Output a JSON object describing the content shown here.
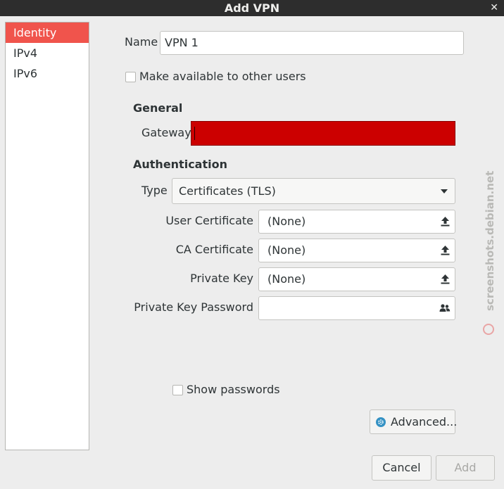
{
  "window": {
    "title": "Add VPN",
    "close_glyph": "✕"
  },
  "sidebar": {
    "items": [
      {
        "label": "Identity",
        "active": true
      },
      {
        "label": "IPv4",
        "active": false
      },
      {
        "label": "IPv6",
        "active": false
      }
    ]
  },
  "identity": {
    "name_label": "Name",
    "name_value": "VPN 1",
    "share_label": "Make available to other users",
    "share_checked": false
  },
  "general": {
    "heading": "General",
    "gateway_label": "Gateway",
    "gateway_value": ""
  },
  "authentication": {
    "heading": "Authentication",
    "type_label": "Type",
    "type_value": "Certificates (TLS)",
    "user_cert_label": "User Certificate",
    "user_cert_value": "(None)",
    "ca_cert_label": "CA Certificate",
    "ca_cert_value": "(None)",
    "private_key_label": "Private Key",
    "private_key_value": "(None)",
    "private_key_password_label": "Private Key Password",
    "private_key_password_value": ""
  },
  "show_passwords_label": "Show passwords",
  "advanced_label": "Advanced...",
  "footer": {
    "cancel_label": "Cancel",
    "add_label": "Add"
  },
  "watermark": "screenshots.debian.net",
  "colors": {
    "selection": "#f0544c",
    "invalid_field": "#cc0000",
    "titlebar": "#2d2d2d",
    "advanced_icon": "#3592c4"
  },
  "icons": {
    "file_chooser": "upload-arrow-icon",
    "password_storage": "users-icon",
    "advanced": "gear-icon"
  }
}
